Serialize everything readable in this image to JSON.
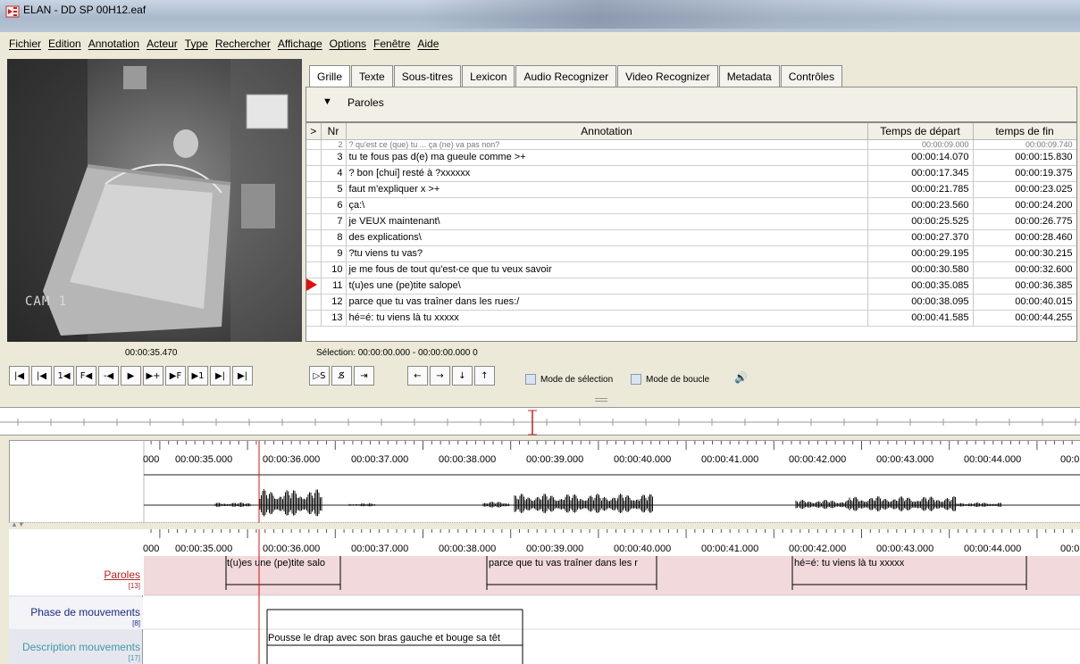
{
  "window": {
    "title": "ELAN - DD SP 00H12.eaf"
  },
  "menu": [
    "Fichier",
    "Edition",
    "Annotation",
    "Acteur",
    "Type",
    "Rechercher",
    "Affichage",
    "Options",
    "Fenêtre",
    "Aide"
  ],
  "video": {
    "cam_label": "CAM  1",
    "timecode": "00:00:35.470"
  },
  "tabs": [
    "Grille",
    "Texte",
    "Sous-titres",
    "Lexicon",
    "Audio Recognizer",
    "Video Recognizer",
    "Metadata",
    "Contrôles"
  ],
  "grid": {
    "tier": "Paroles",
    "headers": {
      "marker": ">",
      "nr": "Nr",
      "annotation": "Annotation",
      "start": "Temps de départ",
      "end": "temps de fin"
    },
    "cut_row": {
      "nr": "2",
      "annotation": "? qu'est ce (que) tu ... ça (ne) va pas non?",
      "start": "00:00:09.000",
      "end": "00:00:09.740"
    },
    "rows": [
      {
        "nr": "3",
        "annotation": "tu te fous pas d(e) ma gueule comme >+",
        "start": "00:00:14.070",
        "end": "00:00:15.830",
        "current": false
      },
      {
        "nr": "4",
        "annotation": "? bon [chui] resté à ?xxxxxx",
        "start": "00:00:17.345",
        "end": "00:00:19.375",
        "current": false
      },
      {
        "nr": "5",
        "annotation": "faut m'expliquer x >+",
        "start": "00:00:21.785",
        "end": "00:00:23.025",
        "current": false
      },
      {
        "nr": "6",
        "annotation": "ça:\\",
        "start": "00:00:23.560",
        "end": "00:00:24.200",
        "current": false
      },
      {
        "nr": "7",
        "annotation": "je VEUX maintenant\\",
        "start": "00:00:25.525",
        "end": "00:00:26.775",
        "current": false
      },
      {
        "nr": "8",
        "annotation": "des explications\\",
        "start": "00:00:27.370",
        "end": "00:00:28.460",
        "current": false
      },
      {
        "nr": "9",
        "annotation": "?tu viens tu vas?",
        "start": "00:00:29.195",
        "end": "00:00:30.215",
        "current": false
      },
      {
        "nr": "10",
        "annotation": "je me fous de tout qu'est-ce que tu veux savoir",
        "start": "00:00:30.580",
        "end": "00:00:32.600",
        "current": false
      },
      {
        "nr": "11",
        "annotation": "t(u)es une (pe)tite salope\\",
        "start": "00:00:35.085",
        "end": "00:00:36.385",
        "current": true
      },
      {
        "nr": "12",
        "annotation": "parce que tu vas traîner dans les rues:/",
        "start": "00:00:38.095",
        "end": "00:00:40.015",
        "current": false
      },
      {
        "nr": "13",
        "annotation": "hé=é: tu viens là tu xxxxx",
        "start": "00:00:41.585",
        "end": "00:00:44.255",
        "current": false
      }
    ]
  },
  "selection": "Sélection: 00:00:00.000 - 00:00:00.000  0",
  "transport": {
    "left": [
      "|◀",
      "|◀",
      "1◀",
      "F◀",
      "-◀",
      "▶",
      "▶+",
      "▶F",
      "▶1",
      "▶|",
      "▶|"
    ],
    "mid": [
      "▷S",
      "S̸",
      "⇥"
    ],
    "arrows": [
      "←",
      "→",
      "↓",
      "↑"
    ],
    "mode_selection": "Mode de sélection",
    "mode_loop": "Mode de boucle"
  },
  "timeline": {
    "ticks": [
      "000",
      "00:00:35.000",
      "00:00:36.000",
      "00:00:37.000",
      "00:00:38.000",
      "00:00:39.000",
      "00:00:40.000",
      "00:00:41.000",
      "00:00:42.000",
      "00:00:43.000",
      "00:00:44.000",
      "00:0"
    ]
  },
  "tiers": [
    {
      "name": "Paroles",
      "count": "[13]",
      "color": "#b22222"
    },
    {
      "name": "Phase de mouvements",
      "count": "[8]",
      "color": "#1a2a8a"
    },
    {
      "name": "Description mouvements",
      "count": "[17]",
      "color": "#3d9aa8"
    }
  ],
  "segments": {
    "paroles": [
      "t(u)es une (pe)tite salo",
      "parce que tu vas traîner dans les r",
      "hé=é: tu viens là tu xxxxx"
    ],
    "description": [
      "Pousse le drap avec son bras gauche et bouge sa têt"
    ]
  },
  "colors": {
    "cursor": "#e01010",
    "paroles_band": "#f2d9dc",
    "accent": "#e01010"
  }
}
